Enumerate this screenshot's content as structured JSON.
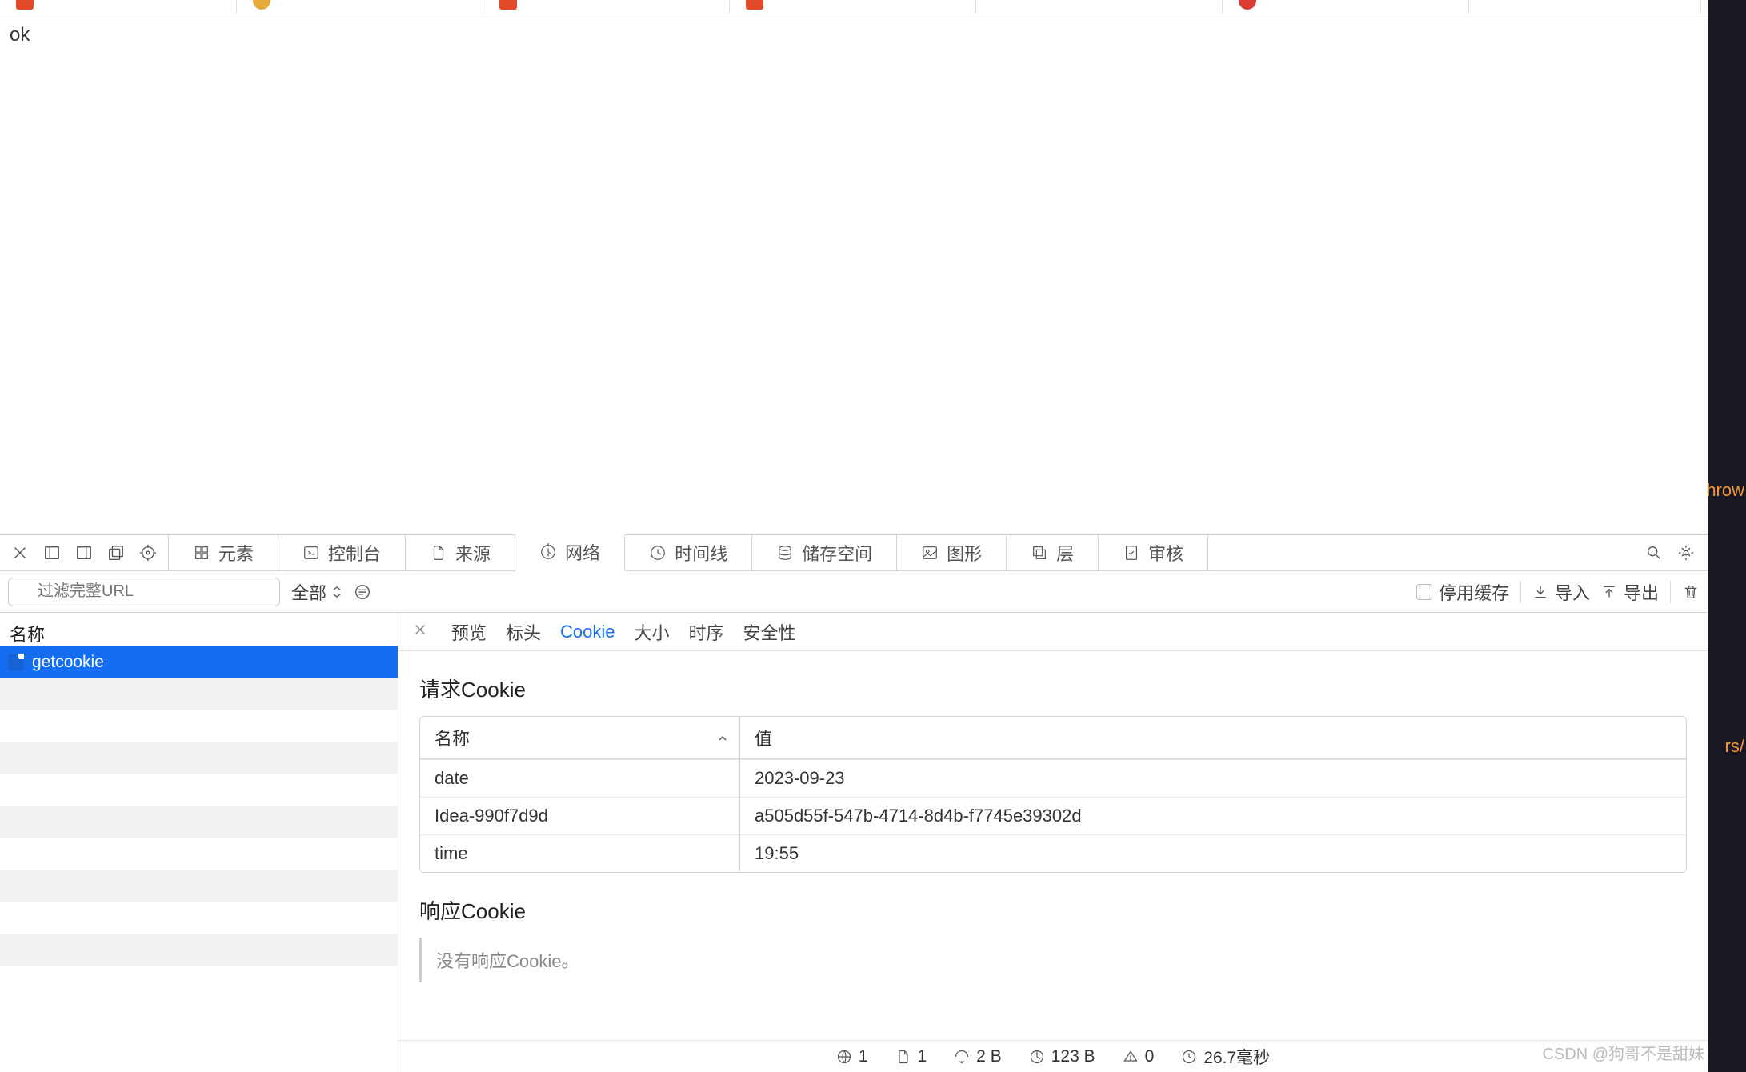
{
  "page_text": "ok",
  "filter": {
    "placeholder": "过滤完整URL",
    "dropdown": "全部",
    "disable_cache": "停用缓存",
    "import": "导入",
    "export": "导出"
  },
  "panel_tabs": [
    "元素",
    "控制台",
    "来源",
    "网络",
    "时间线",
    "储存空间",
    "图形",
    "层",
    "审核"
  ],
  "active_panel_index": 3,
  "request_list": {
    "header": "名称",
    "rows": [
      "getcookie"
    ],
    "selected_index": 0
  },
  "detail_tabs": [
    "预览",
    "标头",
    "Cookie",
    "大小",
    "时序",
    "安全性"
  ],
  "active_detail_index": 2,
  "request_cookie": {
    "title": "请求Cookie",
    "columns": {
      "name": "名称",
      "value": "值"
    },
    "rows": [
      {
        "name": "date",
        "value": "2023-09-23"
      },
      {
        "name": "Idea-990f7d9d",
        "value": "a505d55f-547b-4714-8d4b-f7745e39302d"
      },
      {
        "name": "time",
        "value": "19:55"
      }
    ]
  },
  "response_cookie": {
    "title": "响应Cookie",
    "empty_message": "没有响应Cookie。"
  },
  "status": {
    "requests": "1",
    "domains": "1",
    "transferred": "2 B",
    "resources": "123 B",
    "errors": "0",
    "time": "26.7毫秒"
  },
  "side_strip": {
    "text1": "hrow",
    "text2": "rs/"
  },
  "watermark": "CSDN @狗哥不是甜妹"
}
